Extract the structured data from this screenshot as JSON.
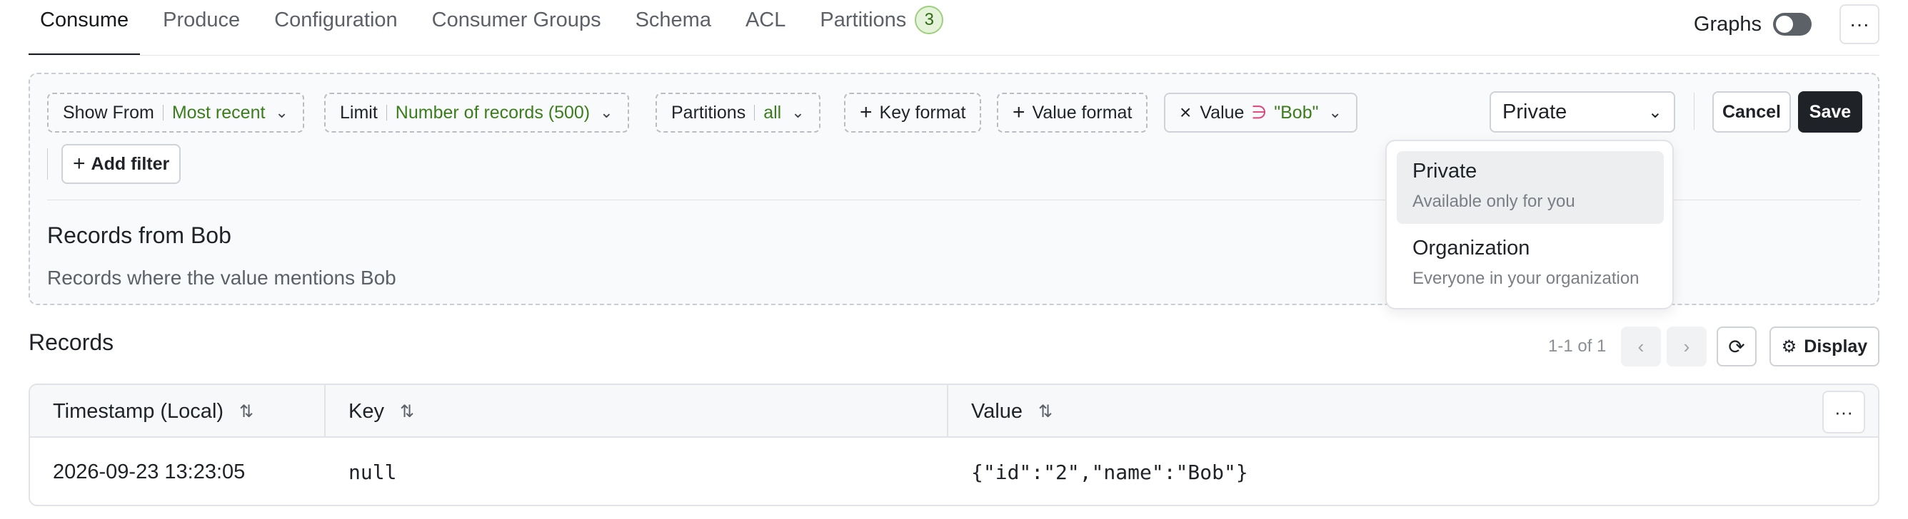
{
  "tabs": [
    {
      "label": "Consume",
      "active": true
    },
    {
      "label": "Produce"
    },
    {
      "label": "Configuration"
    },
    {
      "label": "Consumer Groups"
    },
    {
      "label": "Schema"
    },
    {
      "label": "ACL"
    },
    {
      "label": "Partitions",
      "badge": "3"
    }
  ],
  "header": {
    "graphs_label": "Graphs",
    "graphs_toggle_on": false,
    "more_icon": "ellipsis-icon"
  },
  "filters": {
    "show_from": {
      "label": "Show From",
      "value": "Most recent"
    },
    "limit": {
      "label": "Limit",
      "value": "Number of records (500)"
    },
    "partitions": {
      "label": "Partitions",
      "value": "all"
    },
    "key_format": {
      "label": "Key format"
    },
    "value_format": {
      "label": "Value format"
    },
    "value_filter": {
      "field": "Value",
      "operator": "∋",
      "value": "\"Bob\""
    },
    "add_filter": "Add filter"
  },
  "visibility_select": {
    "selected": "Private",
    "options": [
      {
        "title": "Private",
        "description": "Available only for you"
      },
      {
        "title": "Organization",
        "description": "Everyone in your organization"
      }
    ]
  },
  "actions": {
    "cancel": "Cancel",
    "save": "Save"
  },
  "saved_filter": {
    "title": "Records from Bob",
    "description": "Records where the value mentions Bob"
  },
  "records": {
    "title": "Records",
    "pagination": "1-1 of 1",
    "display_label": "Display",
    "columns": [
      "Timestamp (Local)",
      "Key",
      "Value"
    ],
    "rows": [
      {
        "timestamp": "2026-09-23 13:23:05",
        "key": "null",
        "value": "{\"id\":\"2\",\"name\":\"Bob\"}"
      }
    ]
  },
  "colors": {
    "accent_green": "#3b7d1c",
    "badge_bg": "#e4f3d9",
    "operator_pink": "#e0457a",
    "primary_dark": "#1f2328"
  }
}
